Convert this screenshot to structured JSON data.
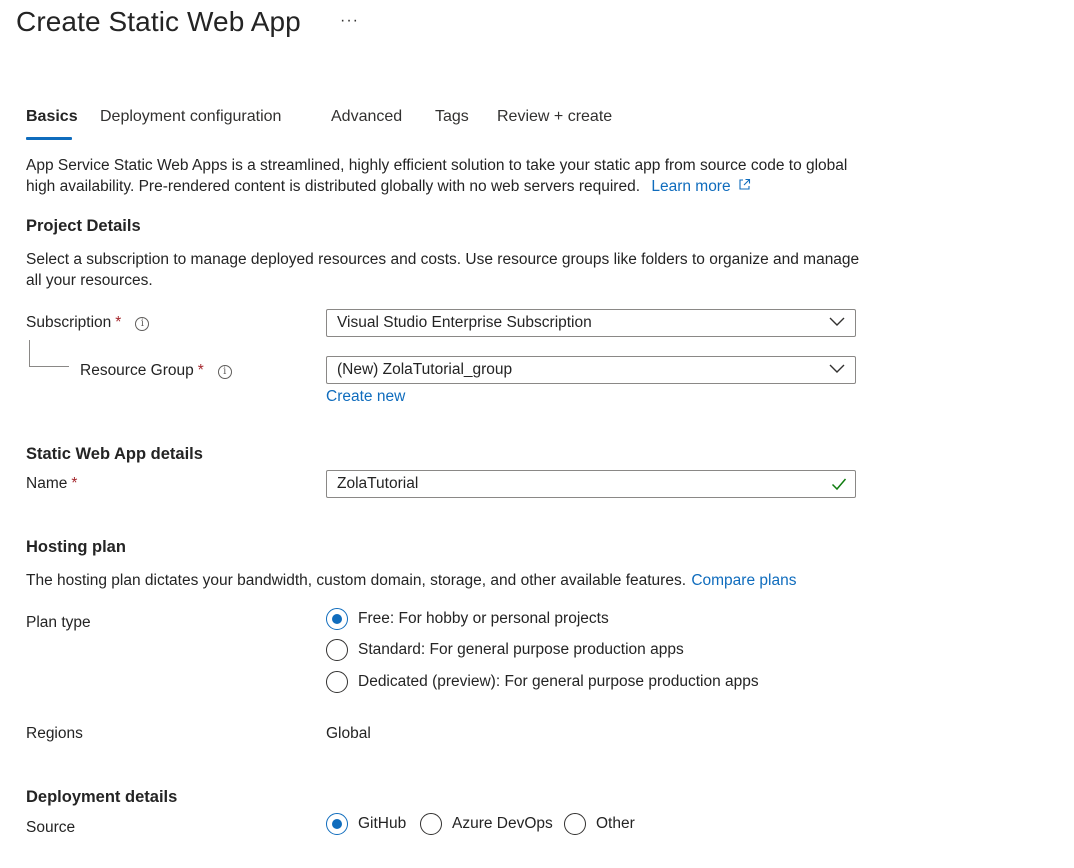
{
  "header": {
    "title": "Create Static Web App",
    "more_label": "···"
  },
  "tabs": [
    {
      "label": "Basics"
    },
    {
      "label": "Deployment configuration"
    },
    {
      "label": "Advanced"
    },
    {
      "label": "Tags"
    },
    {
      "label": "Review + create"
    }
  ],
  "intro": {
    "text": "App Service Static Web Apps is a streamlined, highly efficient solution to take your static app from source code to global high availability. Pre-rendered content is distributed globally with no web servers required.",
    "learn_more": "Learn more"
  },
  "project_details": {
    "title": "Project Details",
    "description": "Select a subscription to manage deployed resources and costs. Use resource groups like folders to organize and manage all your resources.",
    "subscription_label": "Subscription",
    "subscription_value": "Visual Studio Enterprise Subscription",
    "resource_group_label": "Resource Group",
    "resource_group_value": "(New) ZolaTutorial_group",
    "create_new": "Create new"
  },
  "app_details": {
    "title": "Static Web App details",
    "name_label": "Name",
    "name_value": "ZolaTutorial"
  },
  "hosting_plan": {
    "title": "Hosting plan",
    "description": "The hosting plan dictates your bandwidth, custom domain, storage, and other available features.",
    "compare_plans": "Compare plans",
    "plan_type_label": "Plan type",
    "options": [
      {
        "label": "Free: For hobby or personal projects",
        "checked": true
      },
      {
        "label": "Standard: For general purpose production apps",
        "checked": false
      },
      {
        "label": "Dedicated (preview): For general purpose production apps",
        "checked": false
      }
    ],
    "regions_label": "Regions",
    "regions_value": "Global"
  },
  "deployment_details": {
    "title": "Deployment details",
    "source_label": "Source",
    "sources": [
      {
        "label": "GitHub",
        "checked": true
      },
      {
        "label": "Azure DevOps",
        "checked": false
      },
      {
        "label": "Other",
        "checked": false
      }
    ]
  },
  "colors": {
    "accent": "#0f6cbd",
    "required": "#a4262c",
    "success": "#107c10"
  }
}
